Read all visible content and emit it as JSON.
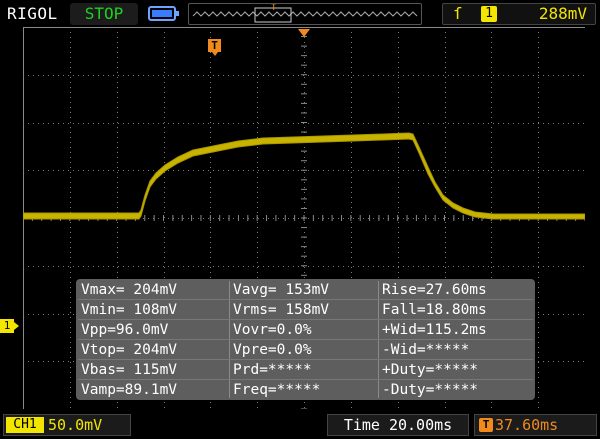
{
  "header": {
    "brand": "RIGOL",
    "run_state": "STOP",
    "trigger": {
      "edge_glyph": "ſ",
      "source": "1",
      "level": "288mV"
    }
  },
  "screen": {
    "trigger_marker_label": "T",
    "channel_marker_label": "1"
  },
  "measurements": [
    [
      "Vmax= 204mV",
      "Vavg= 153mV",
      "Rise=27.60ms"
    ],
    [
      "Vmin= 108mV",
      "Vrms= 158mV",
      "Fall=18.80ms"
    ],
    [
      "Vpp=96.0mV",
      "Vovr=0.0%",
      "+Wid=115.2ms"
    ],
    [
      "Vtop= 204mV",
      "Vpre=0.0%",
      "-Wid=*****"
    ],
    [
      "Vbas= 115mV",
      "Prd=*****",
      "+Duty=*****"
    ],
    [
      "Vamp=89.1mV",
      "Freq=*****",
      "-Duty=*****"
    ]
  ],
  "footer": {
    "channel_tag": "CH1",
    "channel_scale": "50.0mV",
    "timebase": "Time 20.00ms",
    "trigger_offset": "37.60ms",
    "trigger_offset_icon": "T"
  },
  "colors": {
    "trace": "#c8b400",
    "channel": "#f2e600",
    "trigger": "#f08a1c",
    "run_state": "#1fd11f",
    "grid": "#7a7a7a",
    "measure_bg": "#5e5e5e"
  },
  "icons": {
    "battery": "battery-icon",
    "memory": "memory-depth-icon",
    "trigger_edge": "rising-edge-icon"
  }
}
